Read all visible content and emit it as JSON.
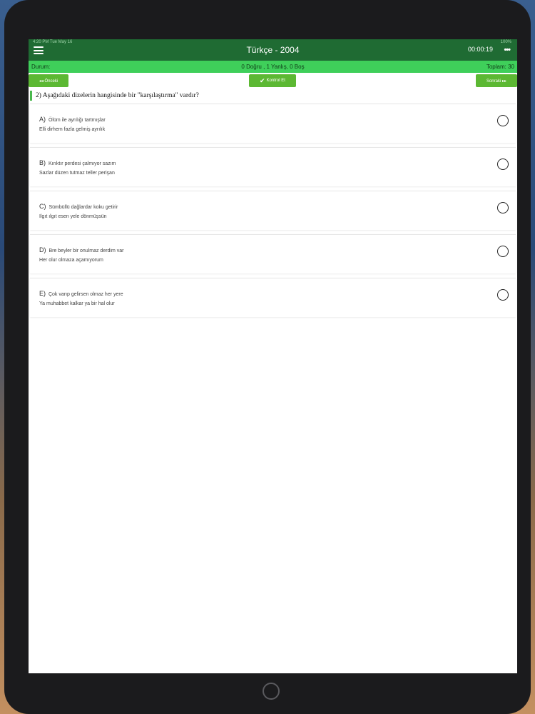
{
  "status_bar": {
    "time_date": "4:20 PM   Tue May 16",
    "battery": "100%"
  },
  "nav": {
    "title": "Türkçe - 2004",
    "timer": "00:00:19",
    "more": "•••"
  },
  "score": {
    "label": "Durum:",
    "summary": "0 Doğru , 1 Yanlış, 0 Boş",
    "total": "Toplam: 30"
  },
  "buttons": {
    "prev": "◂◂ Önceki",
    "check": "Kontrol Et",
    "next": "Sonraki ▸▸",
    "check_icon": "✔"
  },
  "question": {
    "text": "2) Aşağıdaki dizelerin hangisinde bir \"karşılaştırma\" vardır?"
  },
  "options": [
    {
      "letter": "A)",
      "line1": "Ölüm ile ayrılığı tartmışlar",
      "line2": "Elli dirhem fazla gelmiş ayrılık"
    },
    {
      "letter": "B)",
      "line1": "Kırıktır perdesi çalmıyor sazım",
      "line2": "Sazlar düzen tutmaz teller perişan"
    },
    {
      "letter": "C)",
      "line1": "Sümbüllü dağlardar koku getirir",
      "line2": "Ilgıt ılgıt esen yele dönmüşsün"
    },
    {
      "letter": "D)",
      "line1": "Bre beyler bir onulmaz derdim var",
      "line2": "Her olur olmaza açamıyorum"
    },
    {
      "letter": "E)",
      "line1": "Çok varıp gelirsen olmaz her yere",
      "line2": "Ya muhabbet kalkar ya bir hal olur"
    }
  ],
  "colors": {
    "nav": "#1f6b33",
    "score": "#3fcf5a",
    "button": "#5cb833",
    "accent": "#49b84d"
  }
}
